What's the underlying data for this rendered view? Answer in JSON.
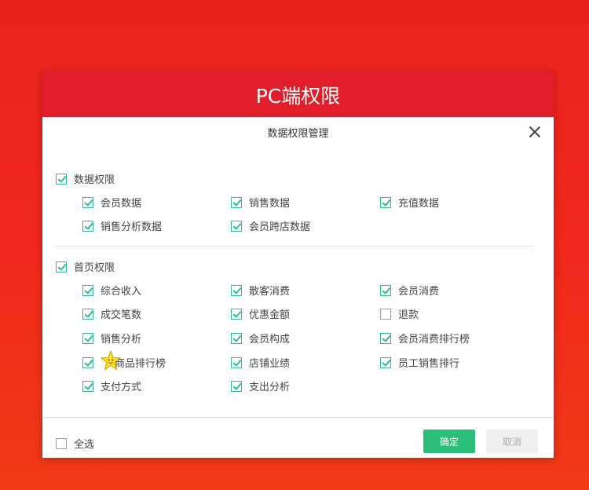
{
  "dialog": {
    "banner_title": "PC端权限",
    "subtitle": "数据权限管理",
    "groups": [
      {
        "label": "数据权限",
        "checked": true,
        "items": [
          {
            "label": "会员数据",
            "checked": true
          },
          {
            "label": "销售数据",
            "checked": true
          },
          {
            "label": "充值数据",
            "checked": true
          },
          {
            "label": "销售分析数据",
            "checked": true
          },
          {
            "label": "会员跨店数据",
            "checked": true
          }
        ]
      },
      {
        "label": "首页权限",
        "checked": true,
        "items": [
          {
            "label": "综合收入",
            "checked": true
          },
          {
            "label": "散客消费",
            "checked": true
          },
          {
            "label": "会员消费",
            "checked": true
          },
          {
            "label": "成交笔数",
            "checked": true
          },
          {
            "label": "优惠金额",
            "checked": true
          },
          {
            "label": "退款",
            "checked": false
          },
          {
            "label": "销售分析",
            "checked": true
          },
          {
            "label": "会员构成",
            "checked": true
          },
          {
            "label": "会员消费排行榜",
            "checked": true
          },
          {
            "label": "商品排行榜",
            "checked": true
          },
          {
            "label": "店铺业绩",
            "checked": true
          },
          {
            "label": "员工销售排行",
            "checked": true
          },
          {
            "label": "支付方式",
            "checked": true
          },
          {
            "label": "支出分析",
            "checked": true
          }
        ]
      }
    ],
    "footer": {
      "select_all_label": "全选",
      "select_all_checked": false,
      "confirm_label": "确定",
      "cancel_label": "取消"
    }
  },
  "colors": {
    "background": "#e8231f",
    "banner": "#e21d2a",
    "accent_green": "#2bbf7a"
  }
}
